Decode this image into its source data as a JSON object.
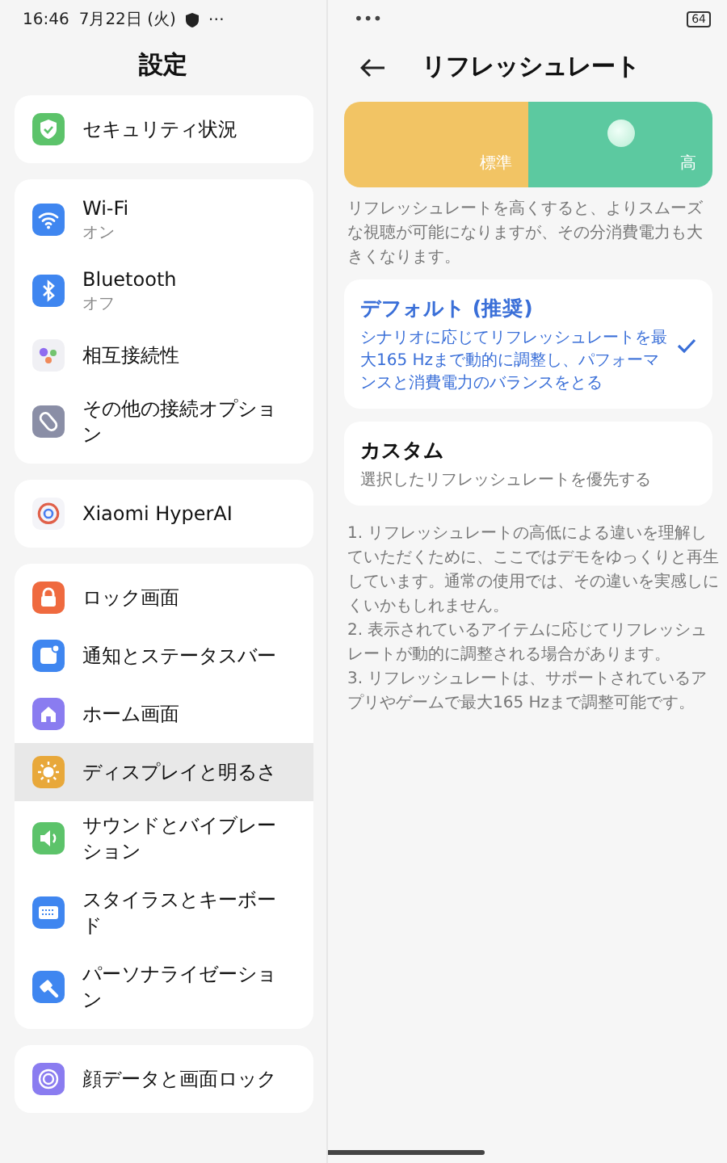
{
  "status_bar": {
    "time": "16:46",
    "date": "7月22日 (火)",
    "more": "⋯",
    "right_more": "•••",
    "battery": "64"
  },
  "sidebar": {
    "title": "設定",
    "groups": [
      {
        "items": [
          {
            "label": "セキュリティ状況",
            "selected": false
          }
        ]
      },
      {
        "items": [
          {
            "label": "Wi-Fi",
            "sub": "オン",
            "selected": false
          },
          {
            "label": "Bluetooth",
            "sub": "オフ",
            "selected": false
          },
          {
            "label": "相互接続性",
            "selected": false
          },
          {
            "label": "その他の接続オプション",
            "selected": false
          }
        ]
      },
      {
        "items": [
          {
            "label": "Xiaomi HyperAI",
            "selected": false
          }
        ]
      },
      {
        "items": [
          {
            "label": "ロック画面",
            "selected": false
          },
          {
            "label": "通知とステータスバー",
            "selected": false
          },
          {
            "label": "ホーム画面",
            "selected": false
          },
          {
            "label": "ディスプレイと明るさ",
            "selected": true
          },
          {
            "label": "サウンドとバイブレーション",
            "selected": false
          },
          {
            "label": "スタイラスとキーボード",
            "selected": false
          },
          {
            "label": "パーソナライゼーション",
            "selected": false
          }
        ]
      },
      {
        "items": [
          {
            "label": "顔データと画面ロック",
            "selected": false
          }
        ]
      }
    ]
  },
  "detail": {
    "title": "リフレッシュレート",
    "rate_options": [
      {
        "label": "標準",
        "color": "#f2c464",
        "selected": false
      },
      {
        "label": "高",
        "color": "#5cc9a0",
        "selected": true
      }
    ],
    "description": "リフレッシュレートを高くすると、よりスムーズな視聴が可能になりますが、その分消費電力も大きくなります。",
    "choices": [
      {
        "title": "デフォルト (推奨)",
        "text": "シナリオに応じてリフレッシュレートを最大165 Hzまで動的に調整し、パフォーマンスと消費電力のバランスをとる",
        "selected": true
      },
      {
        "title": "カスタム",
        "text": "選択したリフレッシュレートを優先する",
        "selected": false
      }
    ],
    "notes": [
      "1. リフレッシュレートの高低による違いを理解していただくために、ここではデモをゆっくりと再生しています。通常の使用では、その違いを実感しにくいかもしれません。",
      "2. 表示されているアイテムに応じてリフレッシュレートが動的に調整される場合があります。",
      "3. リフレッシュレートは、サポートされているアプリやゲームで最大165 Hzまで調整可能です。"
    ]
  }
}
